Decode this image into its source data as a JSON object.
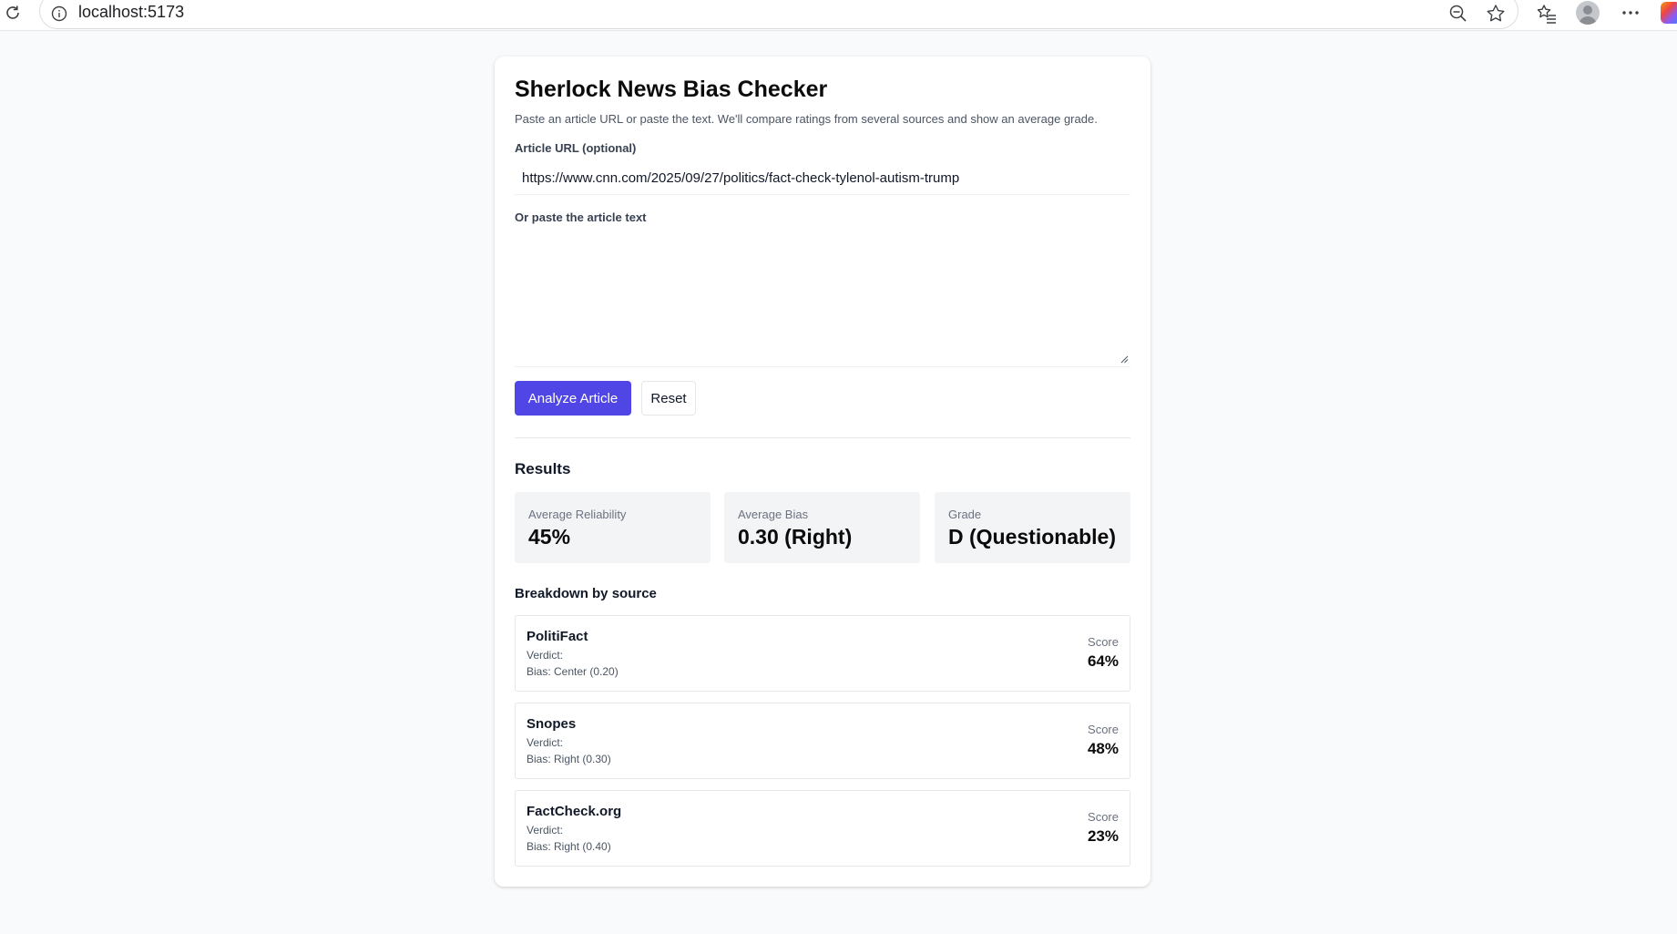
{
  "browser": {
    "url": "localhost:5173",
    "icons": [
      "reload-icon",
      "info-icon",
      "zoom-out-icon",
      "star-icon",
      "favorites-icon",
      "profile-icon",
      "more-icon",
      "copilot-icon"
    ]
  },
  "app": {
    "title": "Sherlock News Bias Checker",
    "subtitle": "Paste an article URL or paste the text. We'll compare ratings from several sources and show an average grade.",
    "url_label": "Article URL (optional)",
    "url_value": "https://www.cnn.com/2025/09/27/politics/fact-check-tylenol-autism-trump",
    "text_label": "Or paste the article text",
    "text_value": "",
    "analyze_button": "Analyze Article",
    "reset_button": "Reset",
    "accent_color": "#4f46e5"
  },
  "results": {
    "heading": "Results",
    "stats": [
      {
        "label": "Average Reliability",
        "value": "45%"
      },
      {
        "label": "Average Bias",
        "value": "0.30 (Right)"
      },
      {
        "label": "Grade",
        "value": "D (Questionable)"
      }
    ],
    "breakdown_heading": "Breakdown by source",
    "sources": [
      {
        "name": "PolitiFact",
        "verdict": "Verdict:",
        "bias": "Bias: Center (0.20)",
        "score_label": "Score",
        "score": "64%"
      },
      {
        "name": "Snopes",
        "verdict": "Verdict:",
        "bias": "Bias: Right (0.30)",
        "score_label": "Score",
        "score": "48%"
      },
      {
        "name": "FactCheck.org",
        "verdict": "Verdict:",
        "bias": "Bias: Right (0.40)",
        "score_label": "Score",
        "score": "23%"
      }
    ]
  }
}
